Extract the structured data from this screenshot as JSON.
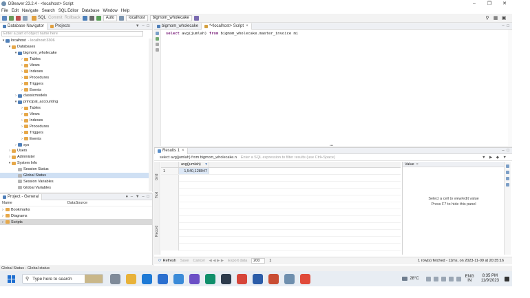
{
  "window": {
    "title": "DBeaver 23.2.4 - <localhost> Script"
  },
  "menu": [
    "File",
    "Edit",
    "Navigate",
    "Search",
    "SQL Editor",
    "Database",
    "Window",
    "Help"
  ],
  "toolbar": {
    "sql_label": "SQL",
    "commit_label": "Commit",
    "rollback_label": "Rollback",
    "auto_label": "Auto",
    "connection_label": "localhost",
    "schema_label": "bigmom_wholecake"
  },
  "navigator": {
    "tab_db": "Database Navigator",
    "tab_projects": "Projects",
    "filter_placeholder": "Enter a part of object name here",
    "tree": [
      {
        "depth": 0,
        "arrow": "v",
        "icon": "db",
        "label": "localhost",
        "sub": "- localhost:3306"
      },
      {
        "depth": 1,
        "arrow": "v",
        "icon": "folder",
        "label": "Databases"
      },
      {
        "depth": 2,
        "arrow": "v",
        "icon": "db",
        "label": "bigmom_wholecake"
      },
      {
        "depth": 3,
        "arrow": ">",
        "icon": "folder",
        "label": "Tables"
      },
      {
        "depth": 3,
        "arrow": ">",
        "icon": "folder",
        "label": "Views"
      },
      {
        "depth": 3,
        "arrow": ">",
        "icon": "folder",
        "label": "Indexes"
      },
      {
        "depth": 3,
        "arrow": ">",
        "icon": "folder",
        "label": "Procedures"
      },
      {
        "depth": 3,
        "arrow": ">",
        "icon": "folder",
        "label": "Triggers"
      },
      {
        "depth": 3,
        "arrow": ">",
        "icon": "folder",
        "label": "Events"
      },
      {
        "depth": 2,
        "arrow": ">",
        "icon": "db",
        "label": "classicmodels"
      },
      {
        "depth": 2,
        "arrow": "v",
        "icon": "db",
        "label": "principal_accounting"
      },
      {
        "depth": 3,
        "arrow": ">",
        "icon": "folder",
        "label": "Tables"
      },
      {
        "depth": 3,
        "arrow": ">",
        "icon": "folder",
        "label": "Views"
      },
      {
        "depth": 3,
        "arrow": ">",
        "icon": "folder",
        "label": "Indexes"
      },
      {
        "depth": 3,
        "arrow": ">",
        "icon": "folder",
        "label": "Procedures"
      },
      {
        "depth": 3,
        "arrow": ">",
        "icon": "folder",
        "label": "Triggers"
      },
      {
        "depth": 3,
        "arrow": ">",
        "icon": "folder",
        "label": "Events"
      },
      {
        "depth": 2,
        "arrow": ">",
        "icon": "db",
        "label": "sys"
      },
      {
        "depth": 1,
        "arrow": ">",
        "icon": "folder",
        "label": "Users"
      },
      {
        "depth": 1,
        "arrow": ">",
        "icon": "folder",
        "label": "Administer"
      },
      {
        "depth": 1,
        "arrow": "v",
        "icon": "folder",
        "label": "System Info"
      },
      {
        "depth": 2,
        "arrow": "",
        "icon": "grey",
        "label": "Session Status"
      },
      {
        "depth": 2,
        "arrow": "",
        "icon": "grey",
        "label": "Global Status",
        "selected": true
      },
      {
        "depth": 2,
        "arrow": "",
        "icon": "grey",
        "label": "Session Variables"
      },
      {
        "depth": 2,
        "arrow": "",
        "icon": "grey",
        "label": "Global Variables"
      }
    ]
  },
  "project": {
    "tab": "Project - General",
    "col_name": "Name",
    "col_source": "DataSource",
    "items": [
      {
        "label": "Bookmarks",
        "selected": false
      },
      {
        "label": "Diagrams",
        "selected": false
      },
      {
        "label": "Scripts",
        "selected": true
      }
    ]
  },
  "editor": {
    "tab1": "bigmom_wholecake",
    "tab2": "*<localhost> Script",
    "sql_keyword1": "select",
    "sql_mid": " avg(jumlah) ",
    "sql_keyword2": "from",
    "sql_rest": " bigmom_wholecake.master_invoice mi"
  },
  "results": {
    "tab": "Results 1",
    "filter_query": "select avg(jumlah) from bigmom_wholecake.n",
    "filter_hint": "Enter a SQL expression to filter results (use Ctrl+Space)",
    "side_grid": "Grid",
    "side_text": "Text",
    "side_record": "Record",
    "column": "avg(jumlah)",
    "rows": [
      {
        "num": "1",
        "value": "1,540,128947"
      }
    ],
    "value_tab": "Value",
    "value_msg1": "Select a cell to view/edit value",
    "value_msg2": "Press F7 to hide this panel",
    "refresh_label": "Refresh",
    "save_label": "Save",
    "cancel_label": "Cancel",
    "export_label": "Export data",
    "page_size": "200",
    "row_count": "1",
    "status": "1 row(s) fetched - 11ms, on 2023-11-09 at 20:35:16"
  },
  "status_bar": {
    "text": "Global Status - Global status"
  },
  "taskbar": {
    "search_placeholder": "Type here to search",
    "weather": "28°C",
    "lang1": "ENG",
    "lang2": "IN",
    "time": "8:35 PM",
    "date": "11/9/2023"
  }
}
